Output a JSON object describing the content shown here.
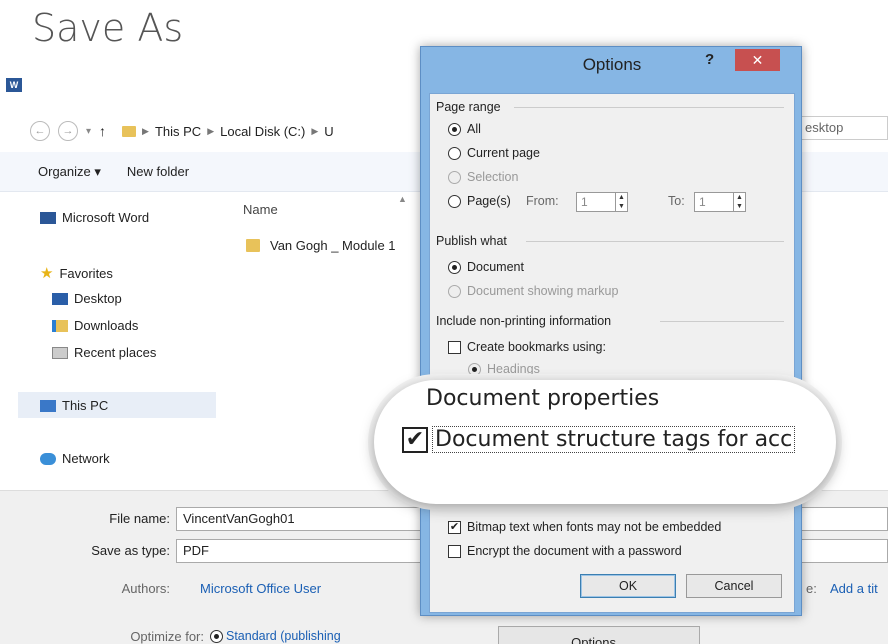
{
  "saveas": {
    "title": "Save As",
    "word_icon": "W",
    "nav": {
      "back": "←",
      "forward": "→",
      "dropdown": "▾",
      "up": "↑"
    },
    "breadcrumbs": [
      "This PC",
      "Local Disk (C:)",
      "U"
    ],
    "search_placeholder": "esktop",
    "toolbar": {
      "organize": "Organize ▾",
      "new_folder": "New folder"
    },
    "sidebar": {
      "word": "Microsoft Word",
      "favorites": "Favorites",
      "desktop": "Desktop",
      "downloads": "Downloads",
      "recent": "Recent places",
      "this_pc": "This PC",
      "network": "Network"
    },
    "column_name": "Name",
    "files": [
      "Van Gogh _ Module 1"
    ],
    "file_name_label": "File name:",
    "file_name_value": "VincentVanGogh01",
    "save_type_label": "Save as type:",
    "save_type_value": "PDF",
    "authors_label": "Authors:",
    "authors_value": "Microsoft Office User",
    "tags_label_fragment": "e:",
    "tags_link": "Add a tit",
    "optimize_label": "Optimize for:",
    "optimize_value": "Standard (publishing",
    "options_button": "Options..."
  },
  "options": {
    "title": "Options",
    "help": "?",
    "close": "✕",
    "page_range": {
      "label": "Page range",
      "all": "All",
      "current": "Current page",
      "selection": "Selection",
      "pages": "Page(s)",
      "from_label": "From:",
      "from_value": "1",
      "to_label": "To:",
      "to_value": "1"
    },
    "publish_what": {
      "label": "Publish what",
      "document": "Document",
      "markup": "Document showing markup"
    },
    "non_printing": {
      "label": "Include non-printing information",
      "bookmarks": "Create bookmarks using:",
      "headings": "Headings"
    },
    "magnified": {
      "doc_properties": "Document properties",
      "structure_tags": "Document structure tags for acc",
      "check": "✔"
    },
    "pdf_options": {
      "bitmap": "Bitmap text when fonts may not be embedded",
      "encrypt": "Encrypt the document with a password",
      "check": "✔"
    },
    "ok": "OK",
    "cancel": "Cancel"
  }
}
